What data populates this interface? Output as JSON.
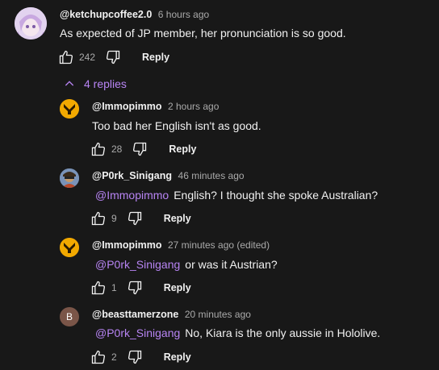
{
  "top_comment": {
    "author": "@ketchupcoffee2.0",
    "time": "6 hours ago",
    "text": "As expected of JP member, her pronunciation is so good.",
    "likes": "242",
    "reply_label": "Reply"
  },
  "replies_toggle": {
    "label": "4 replies"
  },
  "replies": [
    {
      "author": "@Immopimmo",
      "time": "2 hours ago",
      "mention": "",
      "text": "Too bad her English isn't as good.",
      "likes": "28",
      "reply_label": "Reply"
    },
    {
      "author": "@P0rk_Sinigang",
      "time": "46 minutes ago",
      "mention": "@Immopimmo",
      "text": "English? I thought she spoke Australian?",
      "likes": "9",
      "reply_label": "Reply"
    },
    {
      "author": "@Immopimmo",
      "time": "27 minutes ago (edited)",
      "mention": "@P0rk_Sinigang",
      "text": "or was it Austrian?",
      "likes": "1",
      "reply_label": "Reply"
    },
    {
      "author": "@beasttamerzone",
      "time": "20 minutes ago",
      "mention": "@P0rk_Sinigang",
      "text": "No, Kiara is the only aussie in Hololive.",
      "likes": "2",
      "reply_label": "Reply",
      "avatar_letter": "B"
    }
  ],
  "colors": {
    "background": "#181818",
    "mention": "#b784f3",
    "secondary_text": "#aaaaaa"
  }
}
